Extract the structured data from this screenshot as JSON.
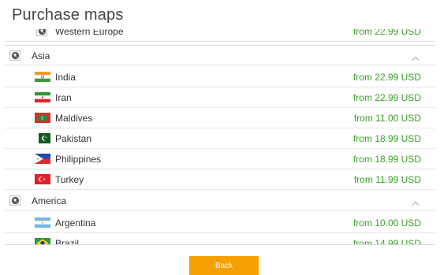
{
  "header": {
    "title": "Purchase maps"
  },
  "list": {
    "top_partial": {
      "name": "Western Europe",
      "price": "from 22.99 USD"
    },
    "groups": [
      {
        "label": "Asia",
        "countries": [
          {
            "name": "India",
            "price": "from 22.99 USD",
            "flag_icon": "india-flag-icon"
          },
          {
            "name": "Iran",
            "price": "from 22.99 USD",
            "flag_icon": "iran-flag-icon"
          },
          {
            "name": "Maldives",
            "price": "from 11.00 USD",
            "flag_icon": "maldives-flag-icon"
          },
          {
            "name": "Pakistan",
            "price": "from 18.99 USD",
            "flag_icon": "pakistan-flag-icon"
          },
          {
            "name": "Philippines",
            "price": "from 18.99 USD",
            "flag_icon": "philippines-flag-icon"
          },
          {
            "name": "Turkey",
            "price": "from 11.99 USD",
            "flag_icon": "turkey-flag-icon"
          }
        ]
      },
      {
        "label": "America",
        "countries": [
          {
            "name": "Argentina",
            "price": "from 10.00 USD",
            "flag_icon": "argentina-flag-icon"
          },
          {
            "name": "Brazil",
            "price": "from 14.99 USD",
            "flag_icon": "brazil-flag-icon"
          }
        ]
      }
    ]
  },
  "footer": {
    "back_label": "Back"
  },
  "colors": {
    "price": "#3aa028",
    "button": "#f5a000",
    "button_text": "#ffffff"
  }
}
